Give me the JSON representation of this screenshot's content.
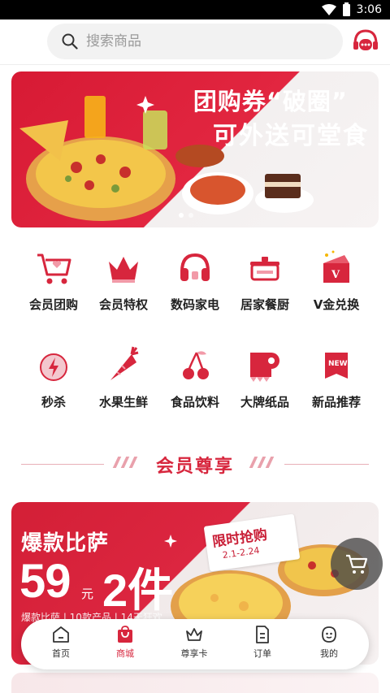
{
  "status_bar": {
    "time": "3:06"
  },
  "search": {
    "placeholder": "搜索商品"
  },
  "banner": {
    "title_line1": "团购券“破圈”",
    "title_line2": "可外送可堂食"
  },
  "categories": [
    {
      "label": "会员团购",
      "icon": "cart-heart-icon"
    },
    {
      "label": "会员特权",
      "icon": "crown-icon"
    },
    {
      "label": "数码家电",
      "icon": "headphones-icon"
    },
    {
      "label": "居家餐厨",
      "icon": "pot-icon"
    },
    {
      "label": "V金兑换",
      "icon": "v-gold-box-icon"
    },
    {
      "label": "秒杀",
      "icon": "lightning-clock-icon"
    },
    {
      "label": "水果生鲜",
      "icon": "carrot-icon"
    },
    {
      "label": "食品饮料",
      "icon": "cherry-icon"
    },
    {
      "label": "大牌纸品",
      "icon": "tissue-roll-icon"
    },
    {
      "label": "新品推荐",
      "icon": "new-tag-icon"
    }
  ],
  "section": {
    "title": "会员尊享"
  },
  "promo": {
    "title": "爆款比萨",
    "price": "59",
    "unit": "元",
    "quantity": "2件",
    "subtitle": "爆款比萨 | 10款产品 | 14天狂欢",
    "tag_title": "限时抢购",
    "tag_date": "2.1-2.24"
  },
  "bottom_nav": [
    {
      "label": "首页",
      "icon": "home-icon"
    },
    {
      "label": "商城",
      "icon": "shopping-bag-icon",
      "active": true
    },
    {
      "label": "尊享卡",
      "icon": "crown-card-icon"
    },
    {
      "label": "订单",
      "icon": "order-list-icon"
    },
    {
      "label": "我的",
      "icon": "profile-face-icon"
    }
  ],
  "colors": {
    "brand_red": "#d7263d",
    "nav_active": "#d7263d"
  }
}
